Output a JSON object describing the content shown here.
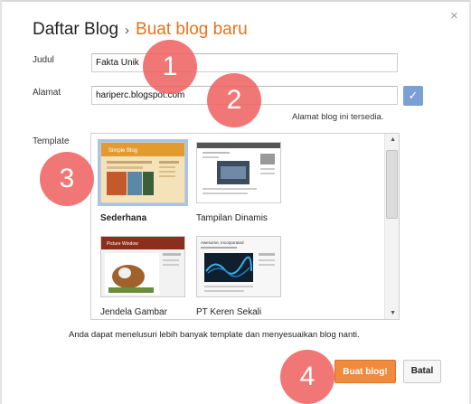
{
  "header": {
    "breadcrumb_parent": "Daftar Blog",
    "separator": "›",
    "breadcrumb_current": "Buat blog baru",
    "close_glyph": "×"
  },
  "form": {
    "title_label": "Judul",
    "title_value": "Fakta Unik",
    "address_label": "Alamat",
    "address_value": "hariperc.blogspot.com",
    "check_glyph": "✓",
    "address_status": "Alamat blog ini tersedia.",
    "template_label": "Template"
  },
  "templates": [
    {
      "name": "Sederhana",
      "selected": true
    },
    {
      "name": "Tampilan Dinamis",
      "selected": false
    },
    {
      "name": "Jendela Gambar",
      "selected": false
    },
    {
      "name": "PT Keren Sekali",
      "selected": false
    }
  ],
  "thumb_text": {
    "simple": "Simple Blog",
    "picture": "Picture Window",
    "awesome": "Awesome, Incorporated"
  },
  "hint": "Anda dapat menelusuri lebih banyak template dan menyesuaikan blog nanti.",
  "buttons": {
    "create": "Buat blog!",
    "cancel": "Batal"
  },
  "markers": [
    "1",
    "2",
    "3",
    "4"
  ],
  "colors": {
    "accent_orange": "#e8731c",
    "create_button": "#f08a3c",
    "check_button": "#7aa0d6",
    "marker": "#ef5f5f"
  }
}
